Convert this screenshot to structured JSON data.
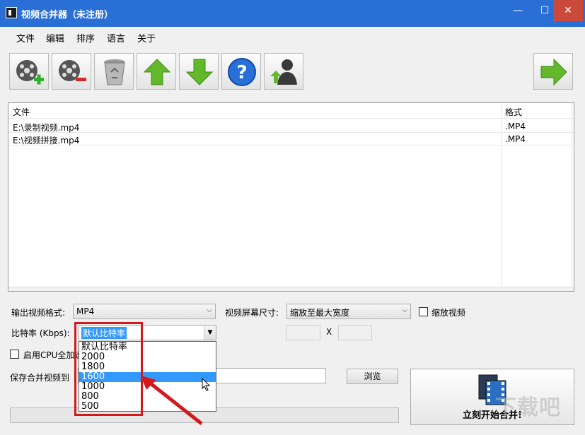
{
  "window": {
    "title": "视频合并器（未注册）",
    "min": "—",
    "max": "☐",
    "close": "✕"
  },
  "menu": [
    "文件",
    "编辑",
    "排序",
    "语言",
    "关于"
  ],
  "toolbar": {
    "buttons": [
      "add-video",
      "remove-video",
      "clear-list",
      "move-up",
      "move-down",
      "help",
      "register",
      "next"
    ]
  },
  "file_list": {
    "columns": [
      "文件",
      "格式"
    ],
    "rows": [
      {
        "file": "E:\\录制视频.mp4",
        "format": ".MP4"
      },
      {
        "file": "E:\\视频拼接.mp4",
        "format": ".MP4"
      }
    ]
  },
  "form": {
    "output_format_label": "输出视频格式:",
    "output_format_value": "MP4",
    "screen_size_label": "视频屏幕尺寸:",
    "screen_size_value": "缩放至最大宽度",
    "zoom_video_label": "缩放视频",
    "bitrate_label": "比特率 (Kbps):",
    "bitrate_value": "默认比特率",
    "size_x_label": "X",
    "cpu_label": "启用CPU全加速",
    "save_to_label": "保存合并视频到",
    "browse_label": "浏览",
    "start_label": "立刻开始合并!"
  },
  "bitrate_options": [
    "默认比特率",
    "2000",
    "1800",
    "1600",
    "1000",
    "800",
    "500"
  ],
  "bitrate_highlighted": "1600",
  "watermark": "下载吧",
  "colors": {
    "titlebar": "#2a6fd6",
    "close": "#c94a3b",
    "highlight": "#3399ff",
    "annotation": "#d4191c"
  }
}
